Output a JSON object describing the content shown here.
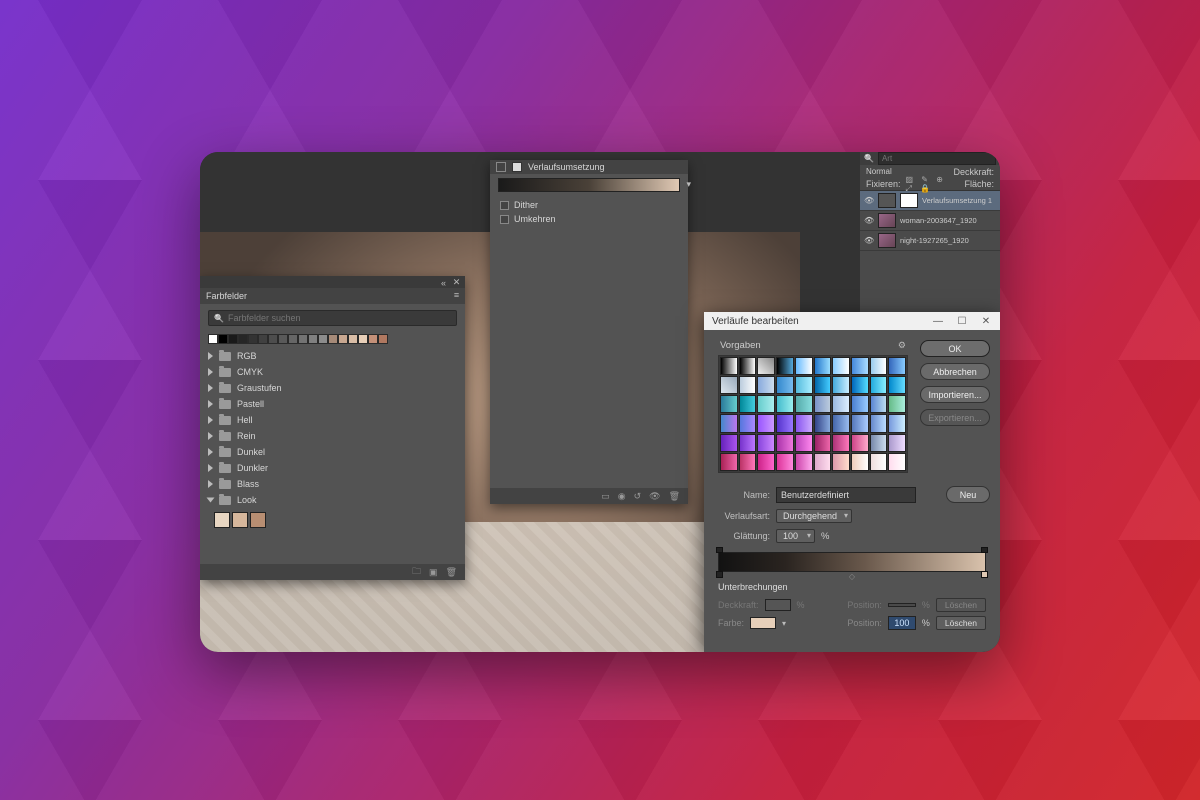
{
  "swatches_panel": {
    "title": "Farbfelder",
    "search_placeholder": "Farbfelder suchen",
    "top_swatches": [
      "#ffffff",
      "#000000",
      "#1a1a1a",
      "#262626",
      "#333333",
      "#404040",
      "#4d4d4d",
      "#595959",
      "#666666",
      "#737373",
      "#808080",
      "#8c8c8c",
      "#a68a78",
      "#c8a790",
      "#d9bda6",
      "#e8cfb8",
      "#c49078",
      "#b07860"
    ],
    "folders": [
      "RGB",
      "CMYK",
      "Graustufen",
      "Pastell",
      "Hell",
      "Rein",
      "Dunkel",
      "Dunkler",
      "Blass",
      "Look"
    ],
    "open_folder": "Look",
    "look_swatches": [
      "#e8d6c2",
      "#d6b79c",
      "#b88e72"
    ]
  },
  "properties_panel": {
    "title": "Verlaufsumsetzung",
    "dither": "Dither",
    "reverse": "Umkehren"
  },
  "layers_panel": {
    "search_placeholder": "Art",
    "mode": "Normal",
    "opacity_label": "Deckkraft:",
    "lock_label": "Fixieren:",
    "fill_label": "Fläche:",
    "layers": [
      {
        "name": "Verlaufsumsetzung 1",
        "selected": true,
        "adjustment": true
      },
      {
        "name": "woman-2003647_1920",
        "selected": false,
        "adjustment": false
      },
      {
        "name": "night-1927265_1920",
        "selected": false,
        "adjustment": false
      }
    ]
  },
  "gradient_editor": {
    "title": "Verläufe bearbeiten",
    "presets_label": "Vorgaben",
    "ok": "OK",
    "cancel": "Abbrechen",
    "import": "Importieren...",
    "export": "Exportieren...",
    "name_label": "Name:",
    "name_value": "Benutzerdefiniert",
    "new_btn": "Neu",
    "type_label": "Verlaufsart:",
    "type_value": "Durchgehend",
    "smooth_label": "Glättung:",
    "smooth_value": "100",
    "pct": "%",
    "stops_label": "Unterbrechungen",
    "opacity_lbl": "Deckkraft:",
    "position_lbl": "Position:",
    "delete_lbl": "Löschen",
    "color_lbl": "Farbe:",
    "color_value": "#e6cfb9",
    "position_value": "100",
    "preset_colors": [
      "linear-gradient(90deg,#000,#fff)",
      "linear-gradient(90deg,#000,#fff)",
      "linear-gradient(45deg,#eee,#888)",
      "linear-gradient(90deg,#000,#5ad)",
      "linear-gradient(90deg,#6bf,#fff)",
      "linear-gradient(90deg,#27c,#9df)",
      "linear-gradient(90deg,#8cf,#fff)",
      "linear-gradient(90deg,#48d,#adf)",
      "linear-gradient(90deg,#9ce,#fff)",
      "linear-gradient(90deg,#36b,#8cf)",
      "linear-gradient(45deg,#dde6ef,#9ab)",
      "linear-gradient(90deg,#bcd,#fff)",
      "linear-gradient(90deg,#8ad,#cde)",
      "linear-gradient(90deg,#38c,#7be)",
      "linear-gradient(90deg,#5bd,#aef)",
      "linear-gradient(90deg,#06a,#4cf)",
      "linear-gradient(90deg,#4ad,#cef)",
      "linear-gradient(90deg,#06b,#5df)",
      "linear-gradient(90deg,#2ad,#8ef)",
      "linear-gradient(90deg,#08c,#6df)",
      "linear-gradient(90deg,#2a7a9a,#6cc)",
      "linear-gradient(90deg,#089,#4cd)",
      "linear-gradient(90deg,#6cc,#aee)",
      "linear-gradient(90deg,#4bc,#9ee)",
      "linear-gradient(90deg,#5aa,#8dd)",
      "linear-gradient(90deg,#7a93c8,#bcd)",
      "linear-gradient(90deg,#9ab8e0,#def)",
      "linear-gradient(90deg,#4a7ed0,#9cf)",
      "linear-gradient(90deg,#5a86d4,#bde)",
      "linear-gradient(90deg,#6b8,#aed)",
      "linear-gradient(90deg,#48c,#b7e)",
      "linear-gradient(90deg,#57d,#a8f)",
      "linear-gradient(90deg,#95f,#c9f)",
      "linear-gradient(90deg,#53c,#97f)",
      "linear-gradient(90deg,#85e,#caf)",
      "linear-gradient(90deg,#348,#8ad)",
      "linear-gradient(90deg,#46a,#9be)",
      "linear-gradient(90deg,#57b,#acf)",
      "linear-gradient(90deg,#68c,#bdf)",
      "linear-gradient(90deg,#79d,#cef)",
      "linear-gradient(90deg,#62b,#a5e)",
      "linear-gradient(90deg,#73c,#b7f)",
      "linear-gradient(90deg,#84d,#c8f)",
      "linear-gradient(90deg,#a3a,#e7d)",
      "linear-gradient(90deg,#b4b,#f8e)",
      "linear-gradient(90deg,#926,#e6a)",
      "linear-gradient(90deg,#a37,#f7b)",
      "linear-gradient(90deg,#c48,#fac)",
      "linear-gradient(90deg,#78a,#cde)",
      "linear-gradient(90deg,#a9c,#edf)",
      "linear-gradient(90deg,#a25,#e6a)",
      "linear-gradient(90deg,#b36,#f7b)",
      "linear-gradient(90deg,#c28,#f6c)",
      "linear-gradient(90deg,#d39,#f8d)",
      "linear-gradient(90deg,#c4a,#fae)",
      "linear-gradient(90deg,#dac,#fde)",
      "linear-gradient(90deg,#d9a,#fdc)",
      "linear-gradient(90deg,#ecb,#fff)",
      "linear-gradient(90deg,#edd,#fff)",
      "linear-gradient(90deg,#fde,#fff)"
    ]
  }
}
